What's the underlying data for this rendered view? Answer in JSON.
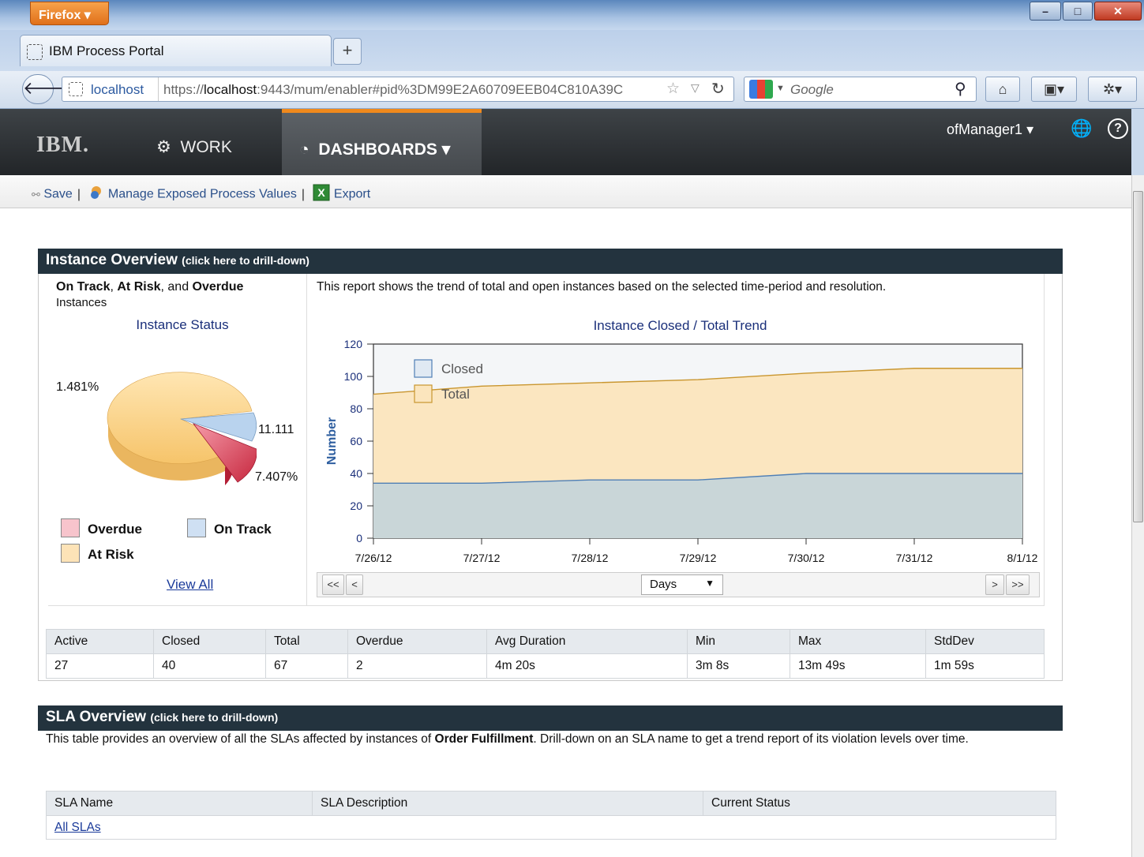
{
  "browser": {
    "menu_label": "Firefox ▾",
    "tab_title": "IBM Process Portal",
    "url_site": "localhost",
    "url_prefix": "https://",
    "url_host": "localhost",
    "url_rest": ":9443/mum/enabler#pid%3DM99E2A60709EEB04C810A39C",
    "search_placeholder": "Google",
    "accent": "#f0891c"
  },
  "portal": {
    "logo": "IBM.",
    "nav": {
      "work": "WORK",
      "dashboards": "DASHBOARDS ▾"
    },
    "user": "ofManager1 ▾",
    "toolbar": {
      "save": "Save",
      "manage": "Manage Exposed Process Values",
      "export": "Export"
    }
  },
  "instance_overview": {
    "title": "Instance Overview",
    "drill": "(click here to drill-down)",
    "status_head_1": "On Track",
    "status_head_2": ", ",
    "status_head_3": "At Risk",
    "status_head_4": ", and ",
    "status_head_5": "Overdue",
    "status_sub": "Instances",
    "status_title": "Instance Status",
    "pie_labels": {
      "at_risk": "1.481%",
      "on_track": "11.111",
      "overdue": "7.407%"
    },
    "legend": {
      "overdue": "Overdue",
      "on_track": "On Track",
      "at_risk": "At Risk"
    },
    "view_all": "View All",
    "report_desc": "This report shows the trend of total and open instances based on the selected time-period and resolution.",
    "trend_title": "Instance Closed / Total Trend",
    "pager": {
      "first": "<<",
      "prev": "<",
      "resolution": "Days",
      "next": ">",
      "last": ">>"
    },
    "stats": {
      "headers": [
        "Active",
        "Closed",
        "Total",
        "Overdue",
        "Avg Duration",
        "Min",
        "Max",
        "StdDev"
      ],
      "row": [
        "27",
        "40",
        "67",
        "2",
        "4m 20s",
        "3m 8s",
        "13m 49s",
        "1m 59s"
      ]
    }
  },
  "sla_overview": {
    "title": "SLA Overview",
    "drill": "(click here to drill-down)",
    "desc_1": "This table provides an overview of all the SLAs affected by instances of ",
    "desc_bold": "Order Fulfillment",
    "desc_2": ". Drill-down on an SLA name to get a trend report of its violation levels over time.",
    "headers": [
      "SLA Name",
      "SLA Description",
      "Current Status"
    ],
    "link": "All SLAs"
  },
  "chart_data": {
    "type": "area",
    "title": "Instance Closed / Total Trend",
    "ylabel": "Number",
    "xlabel": "",
    "x": [
      "7/26/12",
      "7/27/12",
      "7/28/12",
      "7/29/12",
      "7/30/12",
      "7/31/12",
      "8/1/12"
    ],
    "ylim": [
      0,
      120
    ],
    "yticks": [
      0,
      20,
      40,
      60,
      80,
      100,
      120
    ],
    "series": [
      {
        "name": "Closed",
        "values": [
          34,
          34,
          36,
          36,
          40,
          40,
          40
        ],
        "color": "#a9bfd6"
      },
      {
        "name": "Total",
        "values": [
          89,
          94,
          96,
          98,
          102,
          105,
          105
        ],
        "color": "#f3d49b"
      }
    ],
    "legend": "top-left"
  },
  "pie_data": {
    "type": "pie",
    "title": "Instance Status",
    "slices": [
      {
        "name": "At Risk",
        "value": 81.482,
        "color": "#fbd38a"
      },
      {
        "name": "On Track",
        "value": 11.111,
        "color": "#b9d3ee"
      },
      {
        "name": "Overdue",
        "value": 7.407,
        "color": "#e5566c"
      }
    ]
  }
}
